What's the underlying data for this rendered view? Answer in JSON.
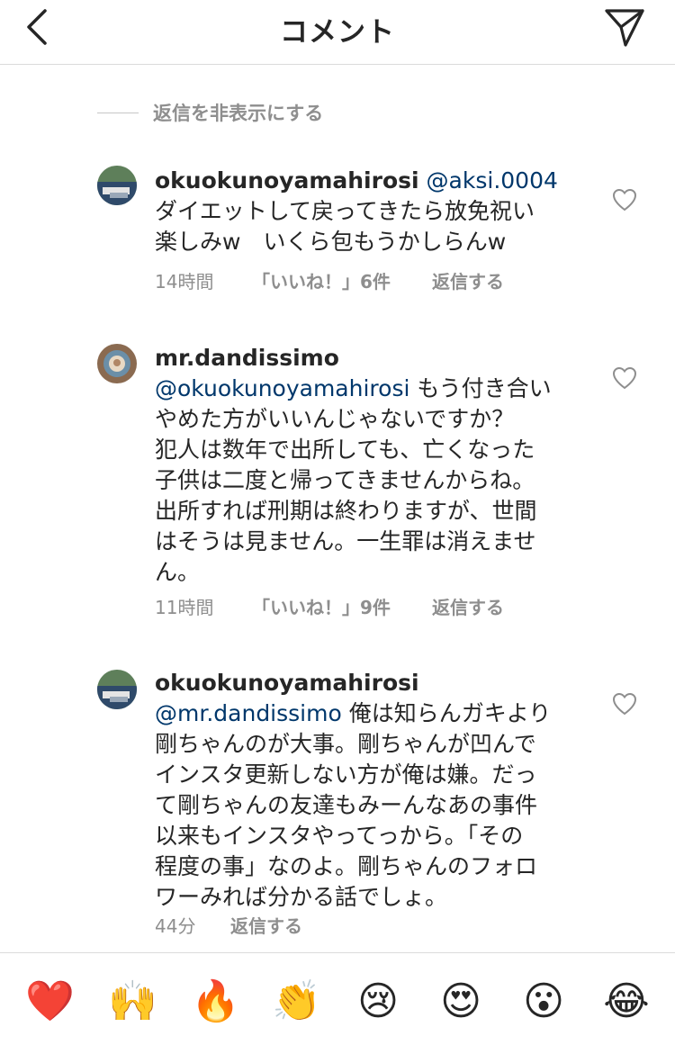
{
  "header": {
    "title": "コメント"
  },
  "hide_replies_label": "返信を非表示にする",
  "comments": [
    {
      "username": "okuokunoyamahirosi",
      "mention": "@aksi.0004",
      "lines": [
        "ダイエットして戻ってきたら放免祝い",
        "楽しみw　いくら包もうかしらんw"
      ],
      "time": "14時間",
      "likes": "「いいね！」6件",
      "reply": "返信する"
    },
    {
      "username": "mr.dandissimo",
      "mention": "@okuokunoyamahirosi",
      "mention_text": "もう付き合い",
      "lines": [
        "やめた方がいいんじゃないですか？",
        "犯人は数年で出所しても、亡くなった",
        "子供は二度と帰ってきませんからね。",
        "出所すれば刑期は終わりますが、世間",
        "はそうは見ません。一生罪は消えませ",
        "ん。"
      ],
      "time": "11時間",
      "likes": "「いいね！」9件",
      "reply": "返信する"
    },
    {
      "username": "okuokunoyamahirosi",
      "mention": "@mr.dandissimo",
      "mention_text": "俺は知らんガキより",
      "lines": [
        "剛ちゃんのが大事。剛ちゃんが凹んで",
        "インスタ更新しない方が俺は嫌。だっ",
        "て剛ちゃんの友達もみーんなあの事件",
        "以来もインスタやってっから。「その",
        "程度の事」なのよ。剛ちゃんのフォロ",
        "ワーみれば分かる話でしょ。"
      ],
      "time": "44分",
      "reply": "返信する"
    }
  ],
  "emoji_bar": [
    "❤️",
    "🙌",
    "🔥",
    "👏",
    "😢",
    "😍",
    "😮",
    "😂"
  ]
}
